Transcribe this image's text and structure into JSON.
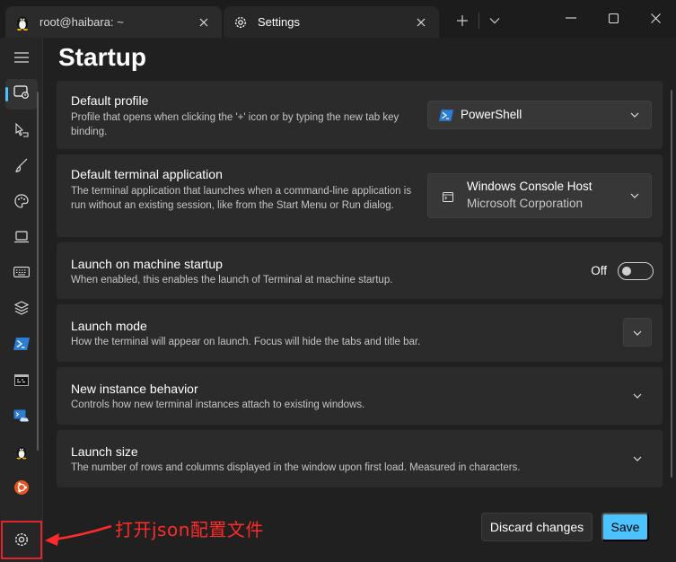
{
  "tabs": [
    {
      "title": "root@haibara: ~",
      "icon": "linux-penguin-icon"
    },
    {
      "title": "Settings",
      "icon": "gear-icon"
    }
  ],
  "window_controls": [
    "minimize",
    "maximize",
    "close"
  ],
  "nav": {
    "items": [
      "menu-icon",
      "startup-icon",
      "interaction-icon",
      "appearance-icon",
      "color-schemes-icon",
      "rendering-icon",
      "actions-icon",
      "profile-defaults-icon",
      "powershell-icon",
      "command-prompt-icon",
      "azure-cloud-shell-icon",
      "linux-penguin-icon",
      "ubuntu-icon",
      "settings-gear-icon"
    ],
    "active": "startup-icon"
  },
  "page": {
    "title": "Startup"
  },
  "settings": {
    "default_profile": {
      "title": "Default profile",
      "description": "Profile that opens when clicking the '+' icon or by typing the new tab key binding.",
      "value": "PowerShell"
    },
    "default_terminal": {
      "title": "Default terminal application",
      "description": "The terminal application that launches when a command-line application is run without an existing session, like from the Start Menu or Run dialog.",
      "value": "Windows Console Host",
      "value_sub": "Microsoft Corporation"
    },
    "launch_on_startup": {
      "title": "Launch on machine startup",
      "description": "When enabled, this enables the launch of Terminal at machine startup.",
      "toggle_label": "Off",
      "toggle_on": false
    },
    "launch_mode": {
      "title": "Launch mode",
      "description": "How the terminal will appear on launch. Focus will hide the tabs and title bar."
    },
    "new_instance": {
      "title": "New instance behavior",
      "description": "Controls how new terminal instances attach to existing windows."
    },
    "launch_size": {
      "title": "Launch size",
      "description": "The number of rows and columns displayed in the window upon first load. Measured in characters."
    }
  },
  "footer": {
    "discard_label": "Discard changes",
    "save_label": "Save"
  },
  "annotation": {
    "text": "打开json配置文件"
  },
  "colors": {
    "accent": "#4cc2ff",
    "annotation": "#ff2a2a",
    "background": "#202020",
    "card": "#2b2b2b"
  }
}
